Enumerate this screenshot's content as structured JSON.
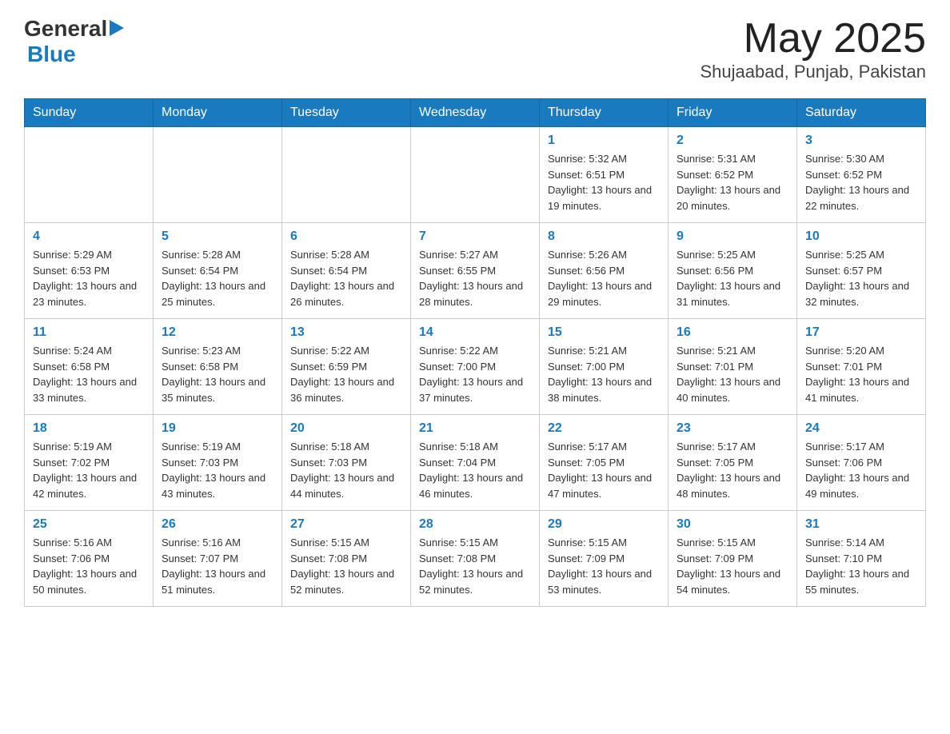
{
  "header": {
    "logo": {
      "general": "General",
      "arrow": "▶",
      "blue": "Blue"
    },
    "title": "May 2025",
    "location": "Shujaabad, Punjab, Pakistan"
  },
  "calendar": {
    "days_of_week": [
      "Sunday",
      "Monday",
      "Tuesday",
      "Wednesday",
      "Thursday",
      "Friday",
      "Saturday"
    ],
    "weeks": [
      {
        "days": [
          {
            "num": "",
            "info": ""
          },
          {
            "num": "",
            "info": ""
          },
          {
            "num": "",
            "info": ""
          },
          {
            "num": "",
            "info": ""
          },
          {
            "num": "1",
            "info": "Sunrise: 5:32 AM\nSunset: 6:51 PM\nDaylight: 13 hours and 19 minutes."
          },
          {
            "num": "2",
            "info": "Sunrise: 5:31 AM\nSunset: 6:52 PM\nDaylight: 13 hours and 20 minutes."
          },
          {
            "num": "3",
            "info": "Sunrise: 5:30 AM\nSunset: 6:52 PM\nDaylight: 13 hours and 22 minutes."
          }
        ]
      },
      {
        "days": [
          {
            "num": "4",
            "info": "Sunrise: 5:29 AM\nSunset: 6:53 PM\nDaylight: 13 hours and 23 minutes."
          },
          {
            "num": "5",
            "info": "Sunrise: 5:28 AM\nSunset: 6:54 PM\nDaylight: 13 hours and 25 minutes."
          },
          {
            "num": "6",
            "info": "Sunrise: 5:28 AM\nSunset: 6:54 PM\nDaylight: 13 hours and 26 minutes."
          },
          {
            "num": "7",
            "info": "Sunrise: 5:27 AM\nSunset: 6:55 PM\nDaylight: 13 hours and 28 minutes."
          },
          {
            "num": "8",
            "info": "Sunrise: 5:26 AM\nSunset: 6:56 PM\nDaylight: 13 hours and 29 minutes."
          },
          {
            "num": "9",
            "info": "Sunrise: 5:25 AM\nSunset: 6:56 PM\nDaylight: 13 hours and 31 minutes."
          },
          {
            "num": "10",
            "info": "Sunrise: 5:25 AM\nSunset: 6:57 PM\nDaylight: 13 hours and 32 minutes."
          }
        ]
      },
      {
        "days": [
          {
            "num": "11",
            "info": "Sunrise: 5:24 AM\nSunset: 6:58 PM\nDaylight: 13 hours and 33 minutes."
          },
          {
            "num": "12",
            "info": "Sunrise: 5:23 AM\nSunset: 6:58 PM\nDaylight: 13 hours and 35 minutes."
          },
          {
            "num": "13",
            "info": "Sunrise: 5:22 AM\nSunset: 6:59 PM\nDaylight: 13 hours and 36 minutes."
          },
          {
            "num": "14",
            "info": "Sunrise: 5:22 AM\nSunset: 7:00 PM\nDaylight: 13 hours and 37 minutes."
          },
          {
            "num": "15",
            "info": "Sunrise: 5:21 AM\nSunset: 7:00 PM\nDaylight: 13 hours and 38 minutes."
          },
          {
            "num": "16",
            "info": "Sunrise: 5:21 AM\nSunset: 7:01 PM\nDaylight: 13 hours and 40 minutes."
          },
          {
            "num": "17",
            "info": "Sunrise: 5:20 AM\nSunset: 7:01 PM\nDaylight: 13 hours and 41 minutes."
          }
        ]
      },
      {
        "days": [
          {
            "num": "18",
            "info": "Sunrise: 5:19 AM\nSunset: 7:02 PM\nDaylight: 13 hours and 42 minutes."
          },
          {
            "num": "19",
            "info": "Sunrise: 5:19 AM\nSunset: 7:03 PM\nDaylight: 13 hours and 43 minutes."
          },
          {
            "num": "20",
            "info": "Sunrise: 5:18 AM\nSunset: 7:03 PM\nDaylight: 13 hours and 44 minutes."
          },
          {
            "num": "21",
            "info": "Sunrise: 5:18 AM\nSunset: 7:04 PM\nDaylight: 13 hours and 46 minutes."
          },
          {
            "num": "22",
            "info": "Sunrise: 5:17 AM\nSunset: 7:05 PM\nDaylight: 13 hours and 47 minutes."
          },
          {
            "num": "23",
            "info": "Sunrise: 5:17 AM\nSunset: 7:05 PM\nDaylight: 13 hours and 48 minutes."
          },
          {
            "num": "24",
            "info": "Sunrise: 5:17 AM\nSunset: 7:06 PM\nDaylight: 13 hours and 49 minutes."
          }
        ]
      },
      {
        "days": [
          {
            "num": "25",
            "info": "Sunrise: 5:16 AM\nSunset: 7:06 PM\nDaylight: 13 hours and 50 minutes."
          },
          {
            "num": "26",
            "info": "Sunrise: 5:16 AM\nSunset: 7:07 PM\nDaylight: 13 hours and 51 minutes."
          },
          {
            "num": "27",
            "info": "Sunrise: 5:15 AM\nSunset: 7:08 PM\nDaylight: 13 hours and 52 minutes."
          },
          {
            "num": "28",
            "info": "Sunrise: 5:15 AM\nSunset: 7:08 PM\nDaylight: 13 hours and 52 minutes."
          },
          {
            "num": "29",
            "info": "Sunrise: 5:15 AM\nSunset: 7:09 PM\nDaylight: 13 hours and 53 minutes."
          },
          {
            "num": "30",
            "info": "Sunrise: 5:15 AM\nSunset: 7:09 PM\nDaylight: 13 hours and 54 minutes."
          },
          {
            "num": "31",
            "info": "Sunrise: 5:14 AM\nSunset: 7:10 PM\nDaylight: 13 hours and 55 minutes."
          }
        ]
      }
    ]
  }
}
